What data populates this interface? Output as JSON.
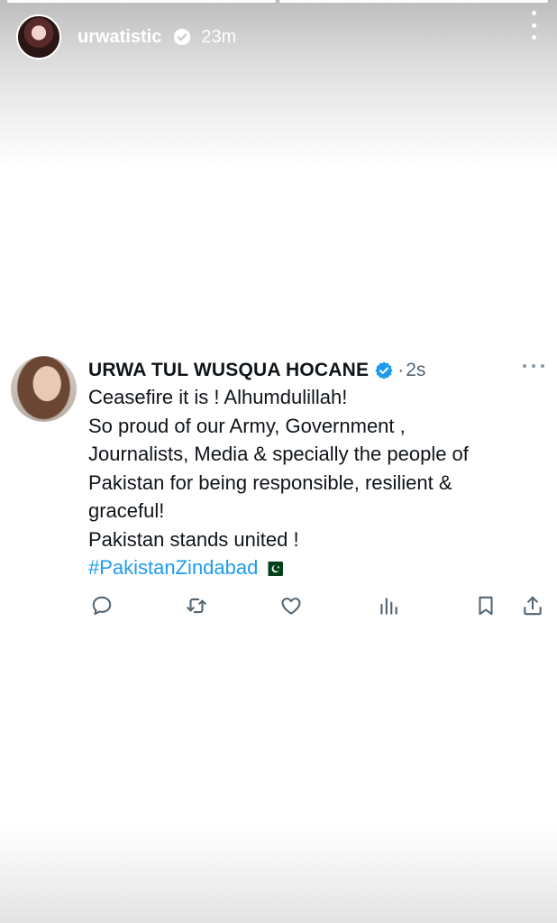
{
  "story": {
    "username": "urwatistic",
    "time_ago": "23m",
    "progress": [
      1.0,
      1.0
    ]
  },
  "tweet": {
    "author_name": "URWA TUL WUSQUA HOCANE",
    "dot": "·",
    "time_ago": "2s",
    "text_lines": [
      "Ceasefire it is ! Alhumdulillah!",
      "So proud of our Army, Government ,",
      "Journalists, Media & specially the people of",
      "Pakistan for being responsible, resilient &",
      "graceful!",
      "Pakistan stands united !"
    ],
    "hashtag": "#PakistanZindabad",
    "flag_icon": "pakistan-flag-icon"
  },
  "actions": [
    "reply-icon",
    "retweet-icon",
    "like-icon",
    "views-icon",
    "bookmark-icon",
    "share-icon"
  ],
  "colors": {
    "link": "#1d9bf0",
    "verified": "#1d9bf0",
    "text": "#0f1419",
    "muted": "#536471"
  }
}
